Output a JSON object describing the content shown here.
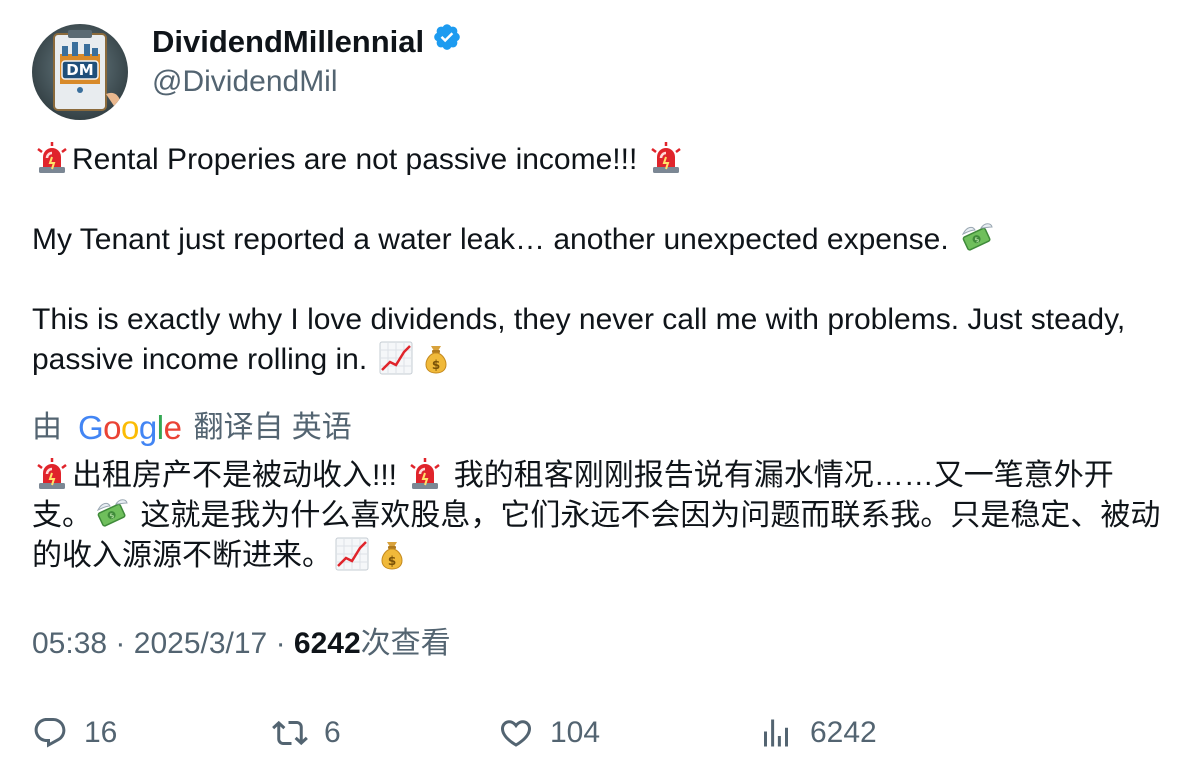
{
  "author": {
    "display_name": "DividendMillennial",
    "handle": "@DividendMil",
    "avatar_text": "DM",
    "verified": true
  },
  "tweet": {
    "line1": "Rental Properies are not passive income!!!",
    "line2": "My Tenant just reported a water leak… another unexpected expense.",
    "line3": "This is exactly why I love dividends, they never call me with problems. Just steady, passive income rolling in."
  },
  "translation": {
    "prefix": "由",
    "google_letters": [
      "G",
      "o",
      "o",
      "g",
      "l",
      "e"
    ],
    "suffix": "翻译自 英语",
    "part1": "出租房产不是被动收入!!!",
    "part2": "我的租客刚刚报告说有漏水情况……又一笔意外开支。",
    "part3": "这就是我为什么喜欢股息，它们永远不会因为问题而联系我。只是稳定、被动的收入源源不断进来。"
  },
  "meta": {
    "time": "05:38",
    "separator": "·",
    "date": "2025/3/17",
    "views": "6242",
    "views_label": "次查看"
  },
  "actions": {
    "replies": "16",
    "reposts": "6",
    "likes": "104",
    "views": "6242"
  },
  "icons": [
    "police-light-icon",
    "money-with-wings-icon",
    "chart-increasing-icon",
    "money-bag-icon",
    "verified-badge-icon",
    "reply-icon",
    "repost-icon",
    "like-icon",
    "views-icon"
  ],
  "colors": {
    "text": "#0f1419",
    "secondary": "#536471",
    "verified": "#1d9bf0",
    "google_blue": "#4285F4",
    "google_red": "#EA4335",
    "google_yellow": "#FBBC05",
    "google_green": "#34A853"
  }
}
